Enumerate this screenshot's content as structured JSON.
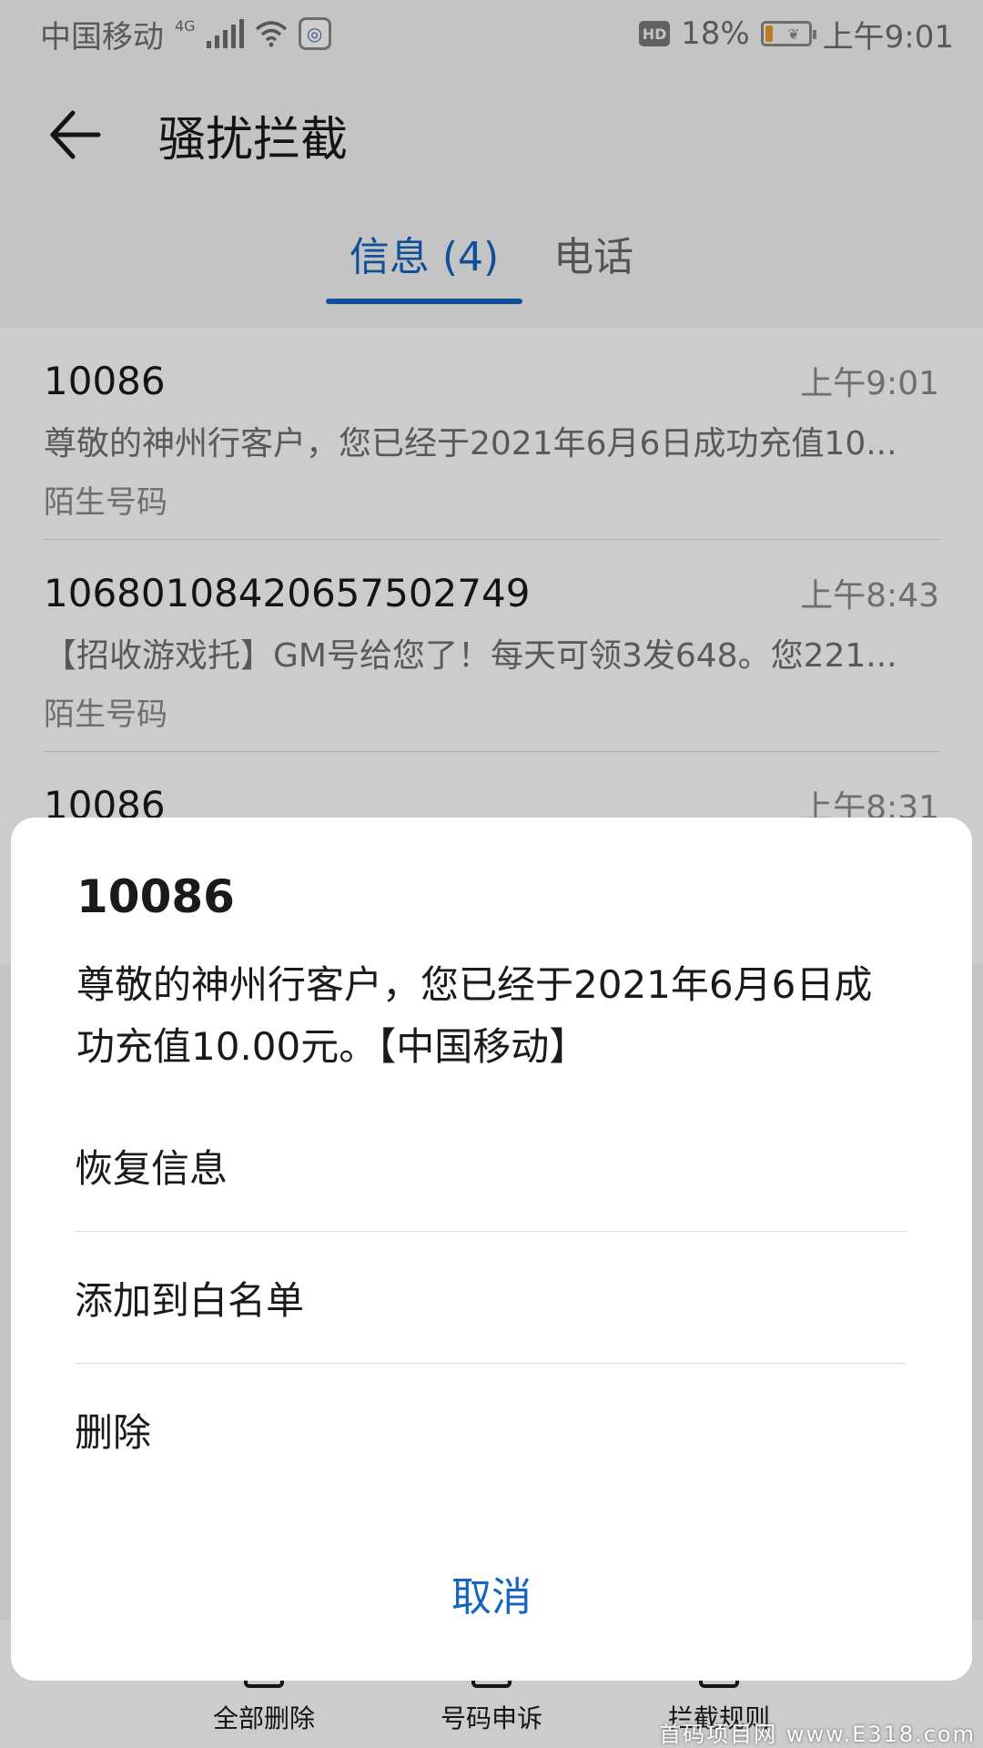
{
  "status_bar": {
    "carrier": "中国移动",
    "network": "4G",
    "battery_percent": "18%",
    "battery_level": 0.18,
    "time": "上午9:01",
    "hd": "HD",
    "icons": [
      "signal-icon",
      "wifi-icon",
      "browser-app-icon",
      "hd-icon",
      "battery-icon"
    ]
  },
  "header": {
    "title": "骚扰拦截"
  },
  "tabs": [
    {
      "label": "信息 (4)",
      "active": true
    },
    {
      "label": "电话",
      "active": false
    }
  ],
  "messages": [
    {
      "sender": "10086",
      "time": "上午9:01",
      "preview": "尊敬的神州行客户，您已经于2021年6月6日成功充值10...",
      "tag": "陌生号码"
    },
    {
      "sender": "10680108420657502749",
      "time": "上午8:43",
      "preview": "【招收游戏托】GM号给您了！每天可领3发648。您221...",
      "tag": "陌生号码"
    },
    {
      "sender": "10086",
      "time": "上午8:31",
      "preview": "",
      "tag": ""
    }
  ],
  "bottom_bar": {
    "items": [
      "全部删除",
      "号码申诉",
      "拦截规则"
    ]
  },
  "sheet": {
    "title": "10086",
    "body": "尊敬的神州行客户，您已经于2021年6月6日成功充值10.00元。【中国移动】",
    "actions": [
      "恢复信息",
      "添加到白名单",
      "删除"
    ],
    "cancel": "取消"
  },
  "watermark": "首码项目网 www.E318.com",
  "colors": {
    "accent": "#1565c0",
    "background": "#f5f5f5",
    "sheet": "#ffffff"
  }
}
